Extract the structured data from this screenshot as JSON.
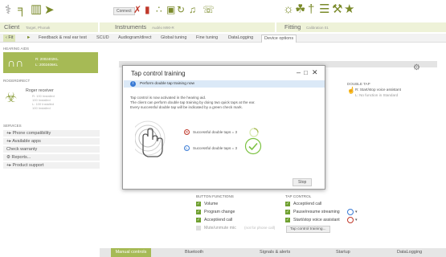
{
  "toolbar": {
    "connect_label": "Connect"
  },
  "client": {
    "label": "Client",
    "name": "Target, Phonak"
  },
  "instruments": {
    "label": "Instruments",
    "device": "Audéo M90-R"
  },
  "fitting": {
    "label": "Fitting",
    "session": "Calibration 01"
  },
  "nav": {
    "back_label": "‹ Fit",
    "feedback_label": "Feedback & real ear test",
    "ucd_label": "SCUD",
    "tabs": [
      "Audiogram/direct",
      "Global tuning",
      "Fine tuning",
      "DataLogging",
      "Device options"
    ]
  },
  "left": {
    "hearing_aids_head": "HEARING AIDS",
    "hearing_aid_r": "R: 2002402KL",
    "hearing_aid_l": "L: 2002406KL",
    "roger_head": "ROGERDIRECT",
    "roger_title": "Roger receiver",
    "roger_lines": [
      "R: 100 Installed",
      "100 Installed",
      "L: 100 Installed",
      "100 Installed"
    ],
    "services_head": "SERVICES",
    "services": [
      "Phone compatibility",
      "Available apps",
      "Check warranty",
      "Reports...",
      "Product support"
    ]
  },
  "bg_panel": {
    "double_tap_head": "DOUBLE TAP",
    "double_tap_r": "R: Start/stop voice assistant",
    "double_tap_l": "L: No function in Standard"
  },
  "dialog": {
    "title": "Tap control training",
    "bar_text": "Perform double tap training now",
    "para": [
      "Tap control is now activated in the hearing aid.",
      "The client can perform double tap training by doing two quick taps at the ear.",
      "Every successful double tap will be indicated by a green check mark."
    ],
    "row_r": "Successful double taps = 3",
    "row_l": "Successful double taps = 3",
    "stop_label": "Stop"
  },
  "button_functions": {
    "head": "BUTTON FUNCTIONS",
    "items": [
      "Volume",
      "Program change",
      "Accept/end call",
      "Mute/unmute mic"
    ],
    "hint": "(not for phone call)"
  },
  "tap_control": {
    "head": "TAP CONTROL",
    "items": [
      "Accept/end call",
      "Pause/resume streaming",
      "Start/stop voice assistant"
    ],
    "training_button": "Tap control training..."
  },
  "bottom_nav": [
    "Manual controls",
    "Bluetooth",
    "Signals & alerts",
    "Startup",
    "DataLogging"
  ],
  "colors": {
    "accent": "#a6ba55",
    "icon_green": "#7a8a2a",
    "record_red": "#c0392b",
    "check_green": "#7cc242"
  }
}
